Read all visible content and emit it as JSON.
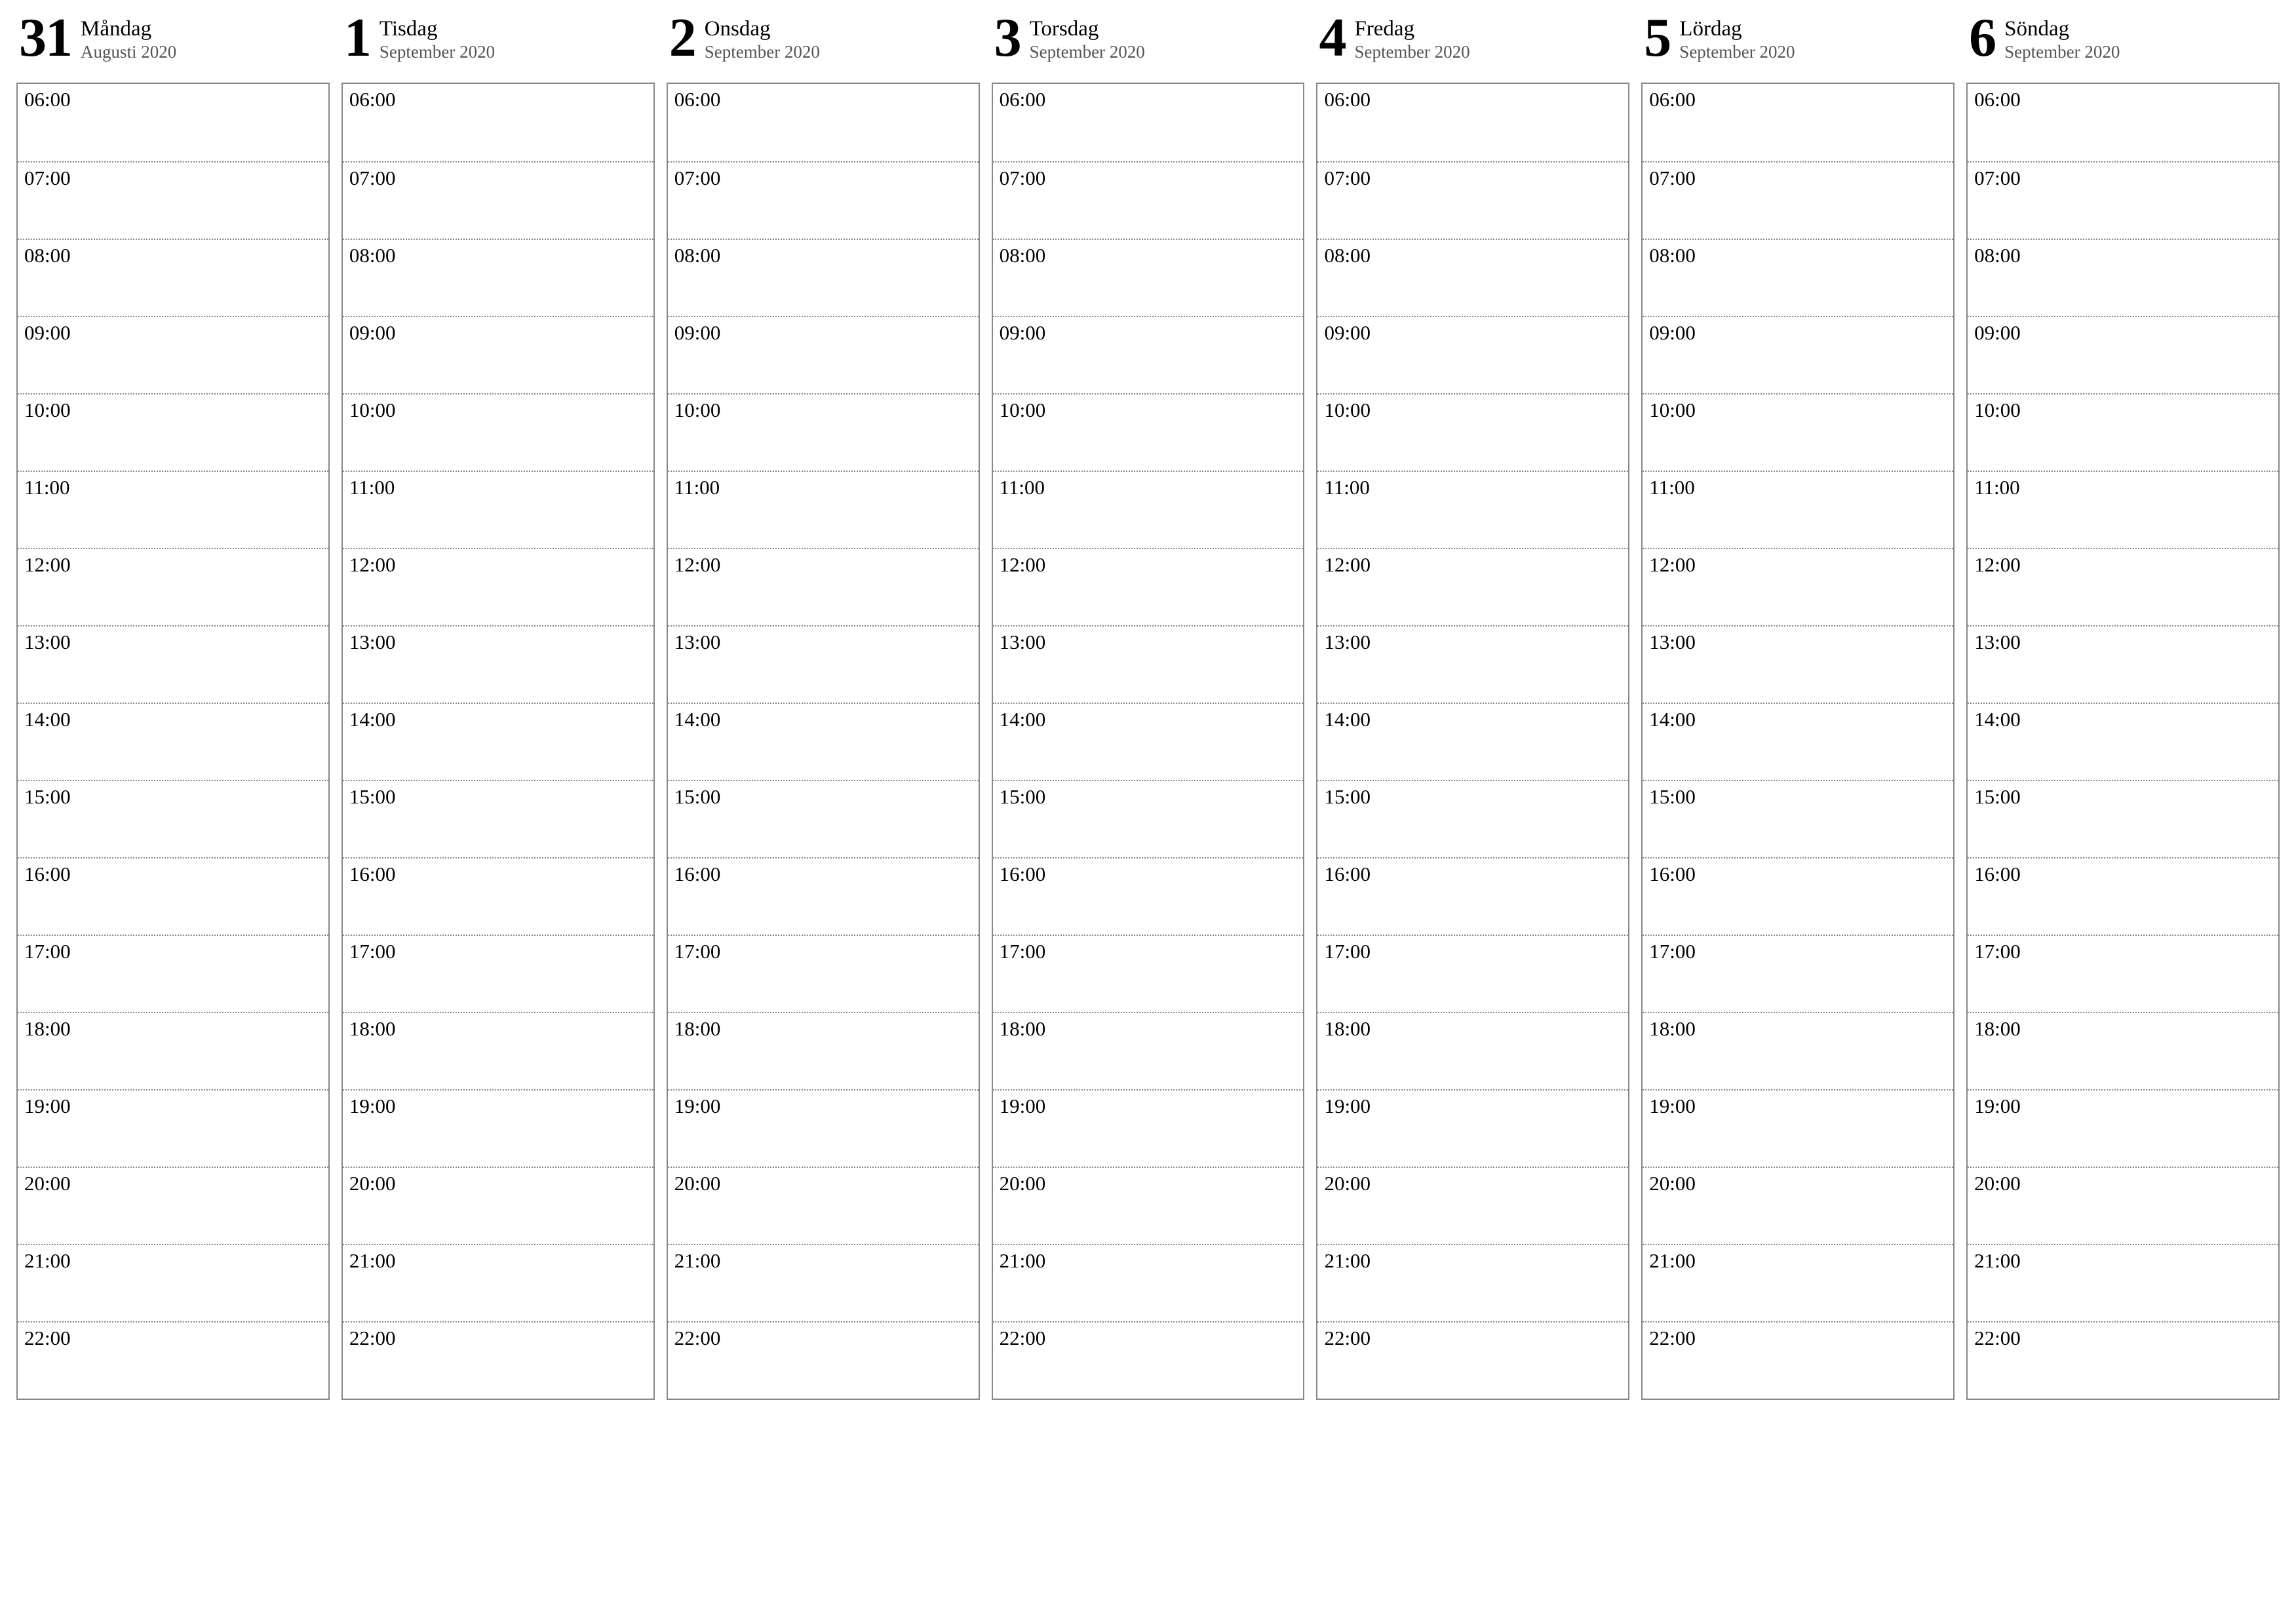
{
  "days": [
    {
      "number": "31",
      "name": "Måndag",
      "month": "Augusti 2020"
    },
    {
      "number": "1",
      "name": "Tisdag",
      "month": "September 2020"
    },
    {
      "number": "2",
      "name": "Onsdag",
      "month": "September 2020"
    },
    {
      "number": "3",
      "name": "Torsdag",
      "month": "September 2020"
    },
    {
      "number": "4",
      "name": "Fredag",
      "month": "September 2020"
    },
    {
      "number": "5",
      "name": "Lördag",
      "month": "September 2020"
    },
    {
      "number": "6",
      "name": "Söndag",
      "month": "September 2020"
    }
  ],
  "times": [
    "06:00",
    "07:00",
    "08:00",
    "09:00",
    "10:00",
    "11:00",
    "12:00",
    "13:00",
    "14:00",
    "15:00",
    "16:00",
    "17:00",
    "18:00",
    "19:00",
    "20:00",
    "21:00",
    "22:00"
  ]
}
